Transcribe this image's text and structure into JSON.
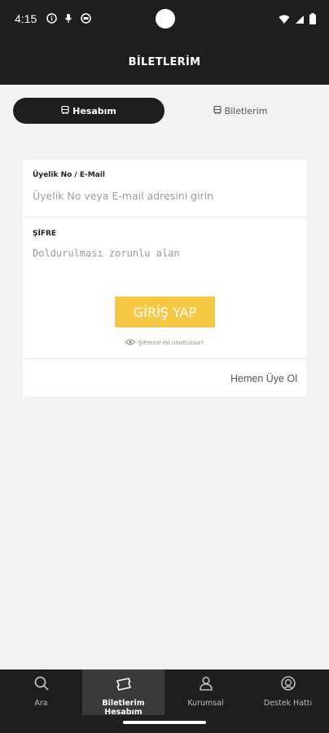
{
  "status": {
    "time": "4:15"
  },
  "header": {
    "title": "BİLETLERİM"
  },
  "tabs": [
    {
      "label": "Hesabım",
      "icon": "bus-icon"
    },
    {
      "label": "Biletlerim",
      "icon": "bus-icon"
    }
  ],
  "form": {
    "user_label": "Üyelik No / E-Mail",
    "user_placeholder": "Üyelik No veya E-mail adresini girin",
    "password_label": "ŞİFRE",
    "password_placeholder": "Doldurulması zorunlu alan",
    "login_label": "GİRİŞ YAP",
    "forgot_label": "Şifrenizi mi unuttunuz?",
    "signup_label": "Hemen Üye Ol"
  },
  "nav": [
    {
      "label": "Ara"
    },
    {
      "label": "Biletlerim Hesabım"
    },
    {
      "label": "Kurumsal"
    },
    {
      "label": "Destek Hattı"
    }
  ],
  "colors": {
    "dark": "#1e1e1e",
    "accent": "#f7c843",
    "background": "#f2f2f2"
  }
}
